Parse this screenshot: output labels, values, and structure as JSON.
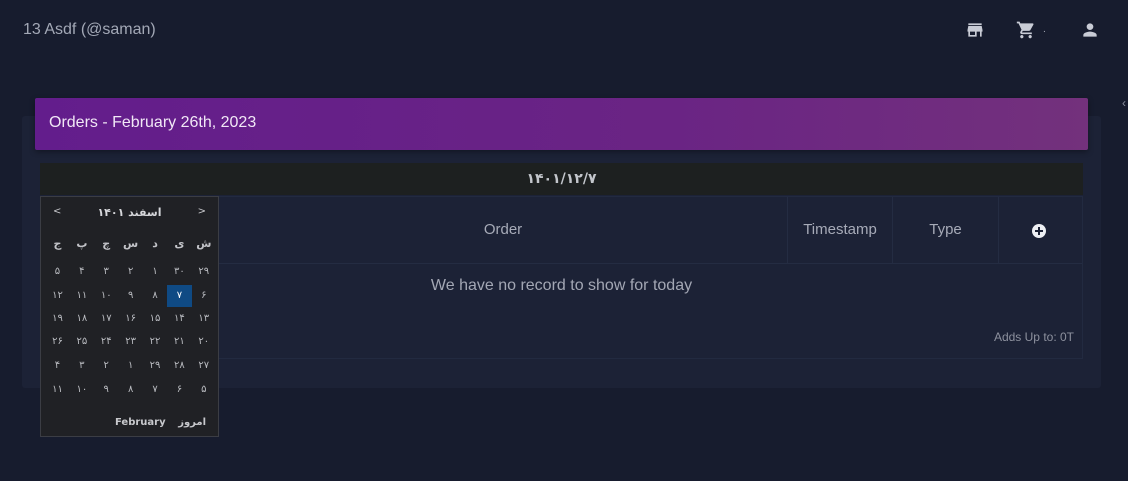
{
  "header": {
    "user_title": "13 Asdf (@saman)",
    "cart_count": "۰",
    "edge_glyph": "‹"
  },
  "page": {
    "title": "Orders - February 26th, 2023",
    "date": "۱۴۰۱/۱۲/۷"
  },
  "table": {
    "columns": [
      "Order",
      "Timestamp",
      "Type"
    ],
    "empty_message": "We have no record to show for today",
    "total": "Adds Up to: 0T"
  },
  "calendar": {
    "prev": "<",
    "next": ">",
    "month_title": "اسفند ۱۴۰۱",
    "weekdays": [
      "ش",
      "ی",
      "د",
      "س",
      "چ",
      "پ",
      "ج"
    ],
    "weeks": [
      [
        "۲۹",
        "۳۰",
        "۱",
        "۲",
        "۳",
        "۴",
        "۵"
      ],
      [
        "۶",
        "۷",
        "۸",
        "۹",
        "۱۰",
        "۱۱",
        "۱۲"
      ],
      [
        "۱۳",
        "۱۴",
        "۱۵",
        "۱۶",
        "۱۷",
        "۱۸",
        "۱۹"
      ],
      [
        "۲۰",
        "۲۱",
        "۲۲",
        "۲۳",
        "۲۴",
        "۲۵",
        "۲۶"
      ],
      [
        "۲۷",
        "۲۸",
        "۲۹",
        "۱",
        "۲",
        "۳",
        "۴"
      ],
      [
        "۵",
        "۶",
        "۷",
        "۸",
        "۹",
        "۱۰",
        "۱۱"
      ]
    ],
    "selected_day": "۷",
    "today_label": "امروز",
    "month_switch_label": "February"
  },
  "colors": {
    "accent": "#631d8c",
    "selected_day": "#0f4a84",
    "background": "#171c2e"
  }
}
